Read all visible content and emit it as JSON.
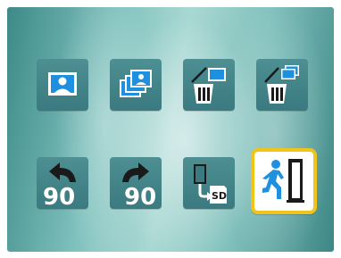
{
  "menu": {
    "items": [
      {
        "id": "play-single",
        "icon": "single-photo-icon"
      },
      {
        "id": "play-multi",
        "icon": "multi-photo-icon"
      },
      {
        "id": "delete-single",
        "icon": "delete-single-icon"
      },
      {
        "id": "delete-all",
        "icon": "delete-all-icon"
      },
      {
        "id": "rotate-left",
        "icon": "rotate-left-90-icon",
        "label": "90"
      },
      {
        "id": "rotate-right",
        "icon": "rotate-right-90-icon",
        "label": "90"
      },
      {
        "id": "copy-to-sd",
        "icon": "copy-to-sd-icon",
        "label": "SD"
      },
      {
        "id": "exit",
        "icon": "exit-icon",
        "selected": true
      }
    ],
    "colors": {
      "tile": "#3f7f84",
      "accent_blue": "#1f8fe0",
      "selection_border": "#f0c419"
    }
  }
}
